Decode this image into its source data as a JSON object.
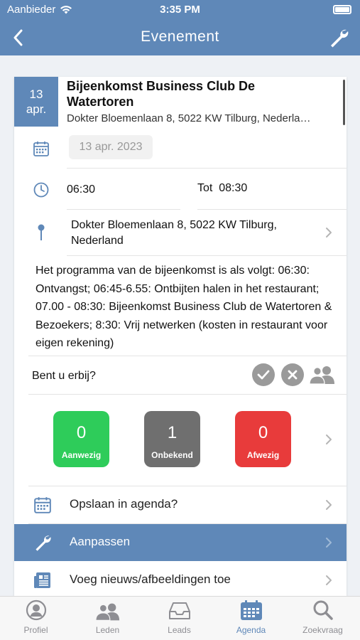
{
  "status_bar": {
    "carrier": "Aanbieder",
    "time": "3:35 PM"
  },
  "nav": {
    "title": "Evenement"
  },
  "event": {
    "day": "13",
    "month": "apr.",
    "title": "Bijeenkomst Business Club De Watertoren",
    "address_short": "Dokter Bloemenlaan 8, 5022 KW Tilburg, Nederla…",
    "date": "13 apr. 2023",
    "start_time": "06:30",
    "end_label": "Tot",
    "end_time": "08:30",
    "location": "Dokter Bloemenlaan 8, 5022 KW Tilburg, Nederland",
    "description": "Het programma van de bijeenkomst is als volgt: 06:30: Ontvangst; 06:45-6.55: Ontbijten halen in het restaurant; 07.00 - 08:30: Bijeenkomst Business Club de Watertoren & Bezoekers; 8:30: Vrij netwerken (kosten in restaurant voor eigen rekening)"
  },
  "attendance": {
    "question": "Bent u erbij?",
    "stats": [
      {
        "count": "0",
        "label": "Aanwezig",
        "color": "#2ecc5a"
      },
      {
        "count": "1",
        "label": "Onbekend",
        "color": "#6f6f6f"
      },
      {
        "count": "0",
        "label": "Afwezig",
        "color": "#e83b3b"
      }
    ]
  },
  "actions": [
    {
      "label": "Opslaan in agenda?",
      "icon": "calendar-icon"
    },
    {
      "label": "Aanpassen",
      "icon": "wrench-icon"
    },
    {
      "label": "Voeg nieuws/afbeeldingen toe",
      "icon": "newspaper-icon"
    }
  ],
  "tabs": [
    {
      "label": "Profiel",
      "icon": "profile-icon"
    },
    {
      "label": "Leden",
      "icon": "members-icon"
    },
    {
      "label": "Leads",
      "icon": "inbox-icon"
    },
    {
      "label": "Agenda",
      "icon": "calendar-icon",
      "active": true
    },
    {
      "label": "Zoekvraag",
      "icon": "search-icon"
    }
  ],
  "colors": {
    "brand": "#5f88b8",
    "present": "#2ecc5a",
    "unknown": "#6f6f6f",
    "absent": "#e83b3b"
  }
}
